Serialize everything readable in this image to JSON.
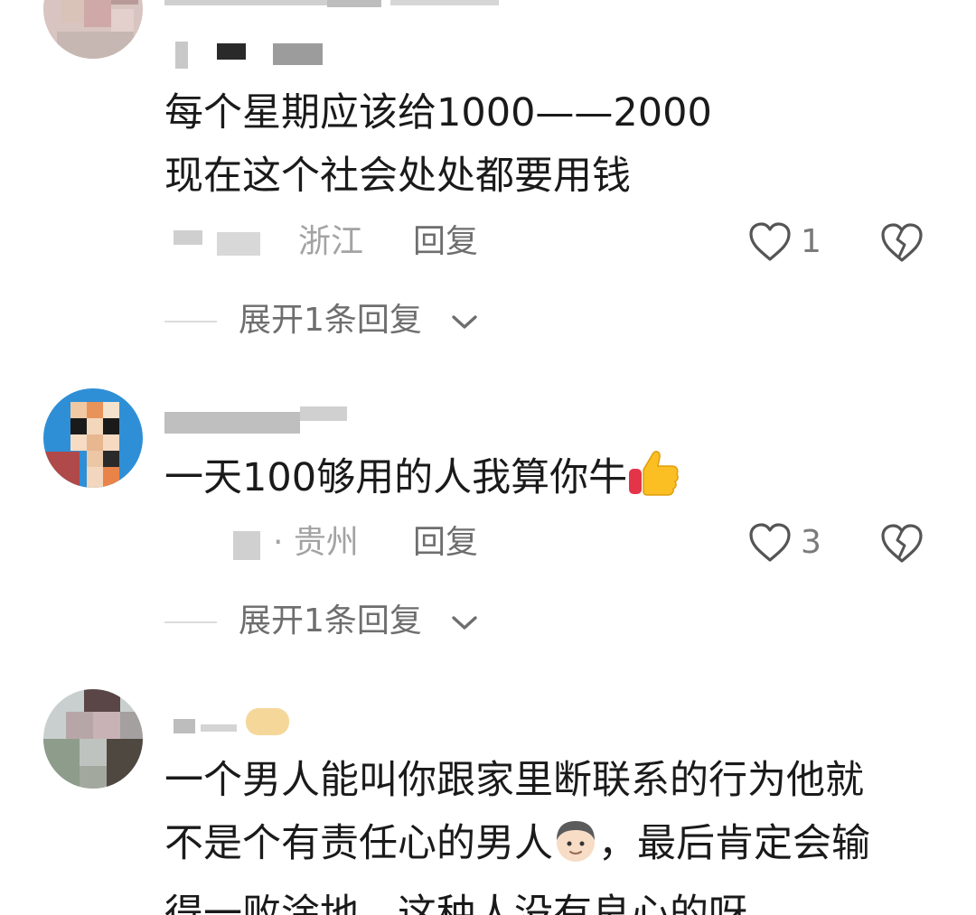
{
  "comments": [
    {
      "username": "",
      "text_lines": [
        "每个星期应该给1000——2000",
        "现在这个社会处处都要用钱"
      ],
      "location": "浙江",
      "reply_label": "回复",
      "like_count": "1",
      "expand_label": "展开1条回复"
    },
    {
      "username": "",
      "text_lines": [
        "一天100够用的人我算你牛"
      ],
      "emoji": "thumbs-up-icon",
      "location": "· 贵州",
      "reply_label": "回复",
      "like_count": "3",
      "expand_label": "展开1条回复"
    },
    {
      "username": "",
      "text_lines": [
        "一个男人能叫你跟家里断联系的行为他就",
        "不是个有责任心的男人",
        "，最后肯定会输",
        "得一败涂地，这种人没有良心的呀"
      ],
      "emoji": "man-face-icon"
    }
  ],
  "colors": {
    "text": "#1a1a1a",
    "meta_gray": "#a3a3a3",
    "action_gray": "#6e6e6e",
    "divider": "#dcdcdc"
  }
}
